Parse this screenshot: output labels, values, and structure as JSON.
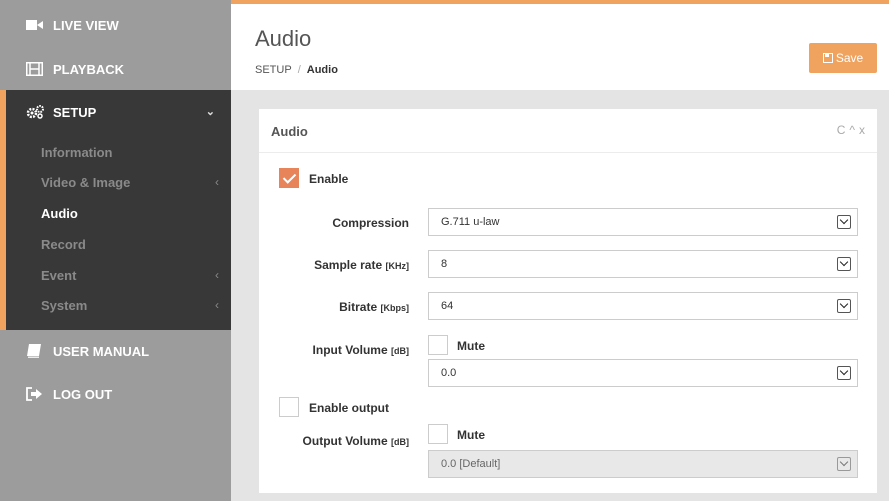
{
  "sidebar": {
    "live_view": "LIVE VIEW",
    "playback": "PLAYBACK",
    "setup": "SETUP",
    "setup_items": [
      {
        "label": "Information",
        "has_submenu": false
      },
      {
        "label": "Video & Image",
        "has_submenu": true
      },
      {
        "label": "Audio",
        "has_submenu": false
      },
      {
        "label": "Record",
        "has_submenu": false
      },
      {
        "label": "Event",
        "has_submenu": true
      },
      {
        "label": "System",
        "has_submenu": true
      }
    ],
    "user_manual": "USER MANUAL",
    "log_out": "LOG OUT",
    "active_item": "Audio"
  },
  "header": {
    "title": "Audio",
    "breadcrumb": [
      "SETUP",
      "Audio"
    ],
    "breadcrumb_sep": "/",
    "save_label": "Save"
  },
  "panel": {
    "title": "Audio",
    "tools": [
      "C",
      "^",
      "x"
    ],
    "enable_label": "Enable",
    "enable_checked": true,
    "compression_label": "Compression",
    "compression_value": "G.711 u-law",
    "sample_rate_label": "Sample rate",
    "sample_rate_unit": "[KHz]",
    "sample_rate_value": "8",
    "bitrate_label": "Bitrate",
    "bitrate_unit": "[Kbps]",
    "bitrate_value": "64",
    "input_volume_label": "Input Volume",
    "input_volume_unit": "[dB]",
    "input_mute_label": "Mute",
    "input_volume_value": "0.0",
    "enable_output_label": "Enable output",
    "output_volume_label": "Output Volume",
    "output_volume_unit": "[dB]",
    "output_mute_label": "Mute",
    "output_volume_value": "0.0 [Default]"
  },
  "colors": {
    "accent": "#f0a35e",
    "checkbox_checked": "#e8845a",
    "sidebar_bg": "#9c9c9c",
    "setup_bg": "#383838"
  }
}
